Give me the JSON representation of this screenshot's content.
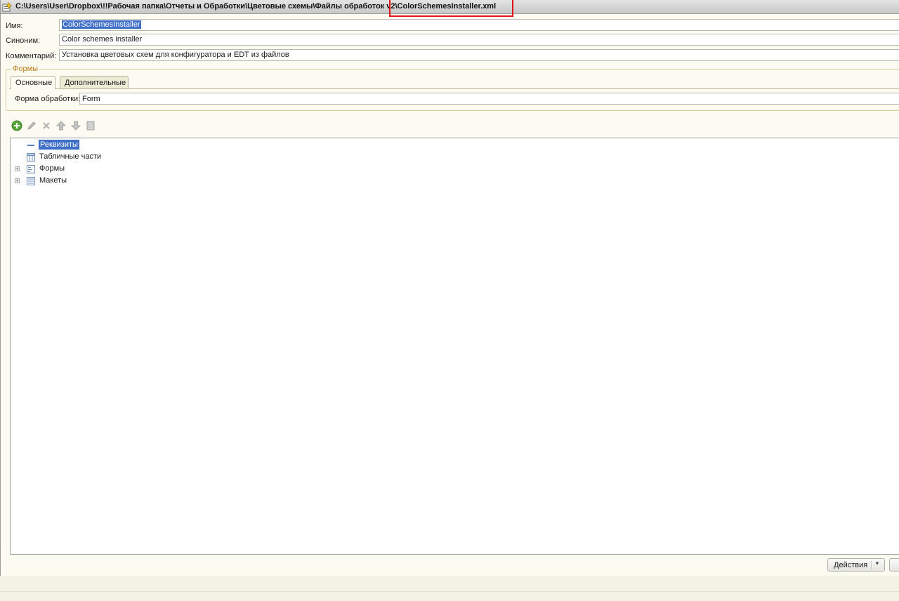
{
  "window": {
    "title": "C:\\Users\\User\\Dropbox\\!!Рабочая папка\\Отчеты и Обработки\\Цветовые схемы\\Файлы обработок v2\\ColorSchemesInstaller.xml",
    "highlight_color": "#e0141a"
  },
  "fields": {
    "name_label": "Имя:",
    "name_value": "ColorSchemesInstaller",
    "synonym_label": "Синоним:",
    "synonym_value": "Color schemes installer",
    "comment_label": "Комментарий:",
    "comment_value": "Установка цветовых схем для конфигуратора и EDT из файлов"
  },
  "forms_group": {
    "legend": "Формы",
    "tabs": [
      {
        "label": "Основные",
        "active": true
      },
      {
        "label": "Дополнительные",
        "active": false
      }
    ],
    "form_label": "Форма обработки:",
    "form_value": "Form"
  },
  "toolbar": {
    "icons": [
      "add-icon",
      "edit-icon",
      "delete-icon",
      "move-up-icon",
      "move-down-icon",
      "list-icon"
    ]
  },
  "tree": {
    "items": [
      {
        "label": "Реквизиты",
        "icon": "attribute-icon",
        "expandable": false,
        "selected": true
      },
      {
        "label": "Табличные части",
        "icon": "table-icon",
        "expandable": false,
        "selected": false
      },
      {
        "label": "Формы",
        "icon": "form-icon",
        "expandable": true,
        "selected": false
      },
      {
        "label": "Макеты",
        "icon": "template-icon",
        "expandable": true,
        "selected": false
      }
    ]
  },
  "footer": {
    "actions_label": "Действия"
  },
  "colors": {
    "selection": "#3e6fc8",
    "legend": "#c07c1a"
  }
}
